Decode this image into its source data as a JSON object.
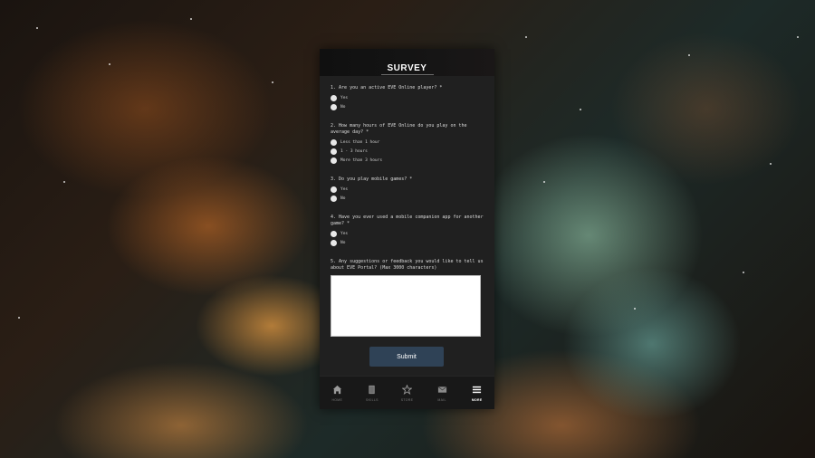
{
  "header": {
    "title": "SURVEY"
  },
  "questions": [
    {
      "text": "1. Are you an active EVE Online player? *",
      "options": [
        "Yes",
        "No"
      ]
    },
    {
      "text": "2. How many hours of EVE Online do you play on the average day? *",
      "options": [
        "Less than 1 hour",
        "1 - 3 hours",
        "More than 3 hours"
      ]
    },
    {
      "text": "3. Do you play mobile games? *",
      "options": [
        "Yes",
        "No"
      ]
    },
    {
      "text": "4. Have you ever used a mobile companion app for another game? *",
      "options": [
        "Yes",
        "No"
      ]
    },
    {
      "text": "5. Any suggestions or feedback you would like to tell us about EVE Portal? (Max 3000 characters)"
    }
  ],
  "feedback": {
    "value": ""
  },
  "submit_label": "Submit",
  "nav": [
    {
      "label": "HOME",
      "icon": "home-icon",
      "active": false
    },
    {
      "label": "SKILLS",
      "icon": "skills-book-icon",
      "active": false
    },
    {
      "label": "STORE",
      "icon": "store-star-icon",
      "active": false
    },
    {
      "label": "MAIL",
      "icon": "mail-icon",
      "active": false
    },
    {
      "label": "MORE",
      "icon": "menu-icon",
      "active": true
    }
  ]
}
